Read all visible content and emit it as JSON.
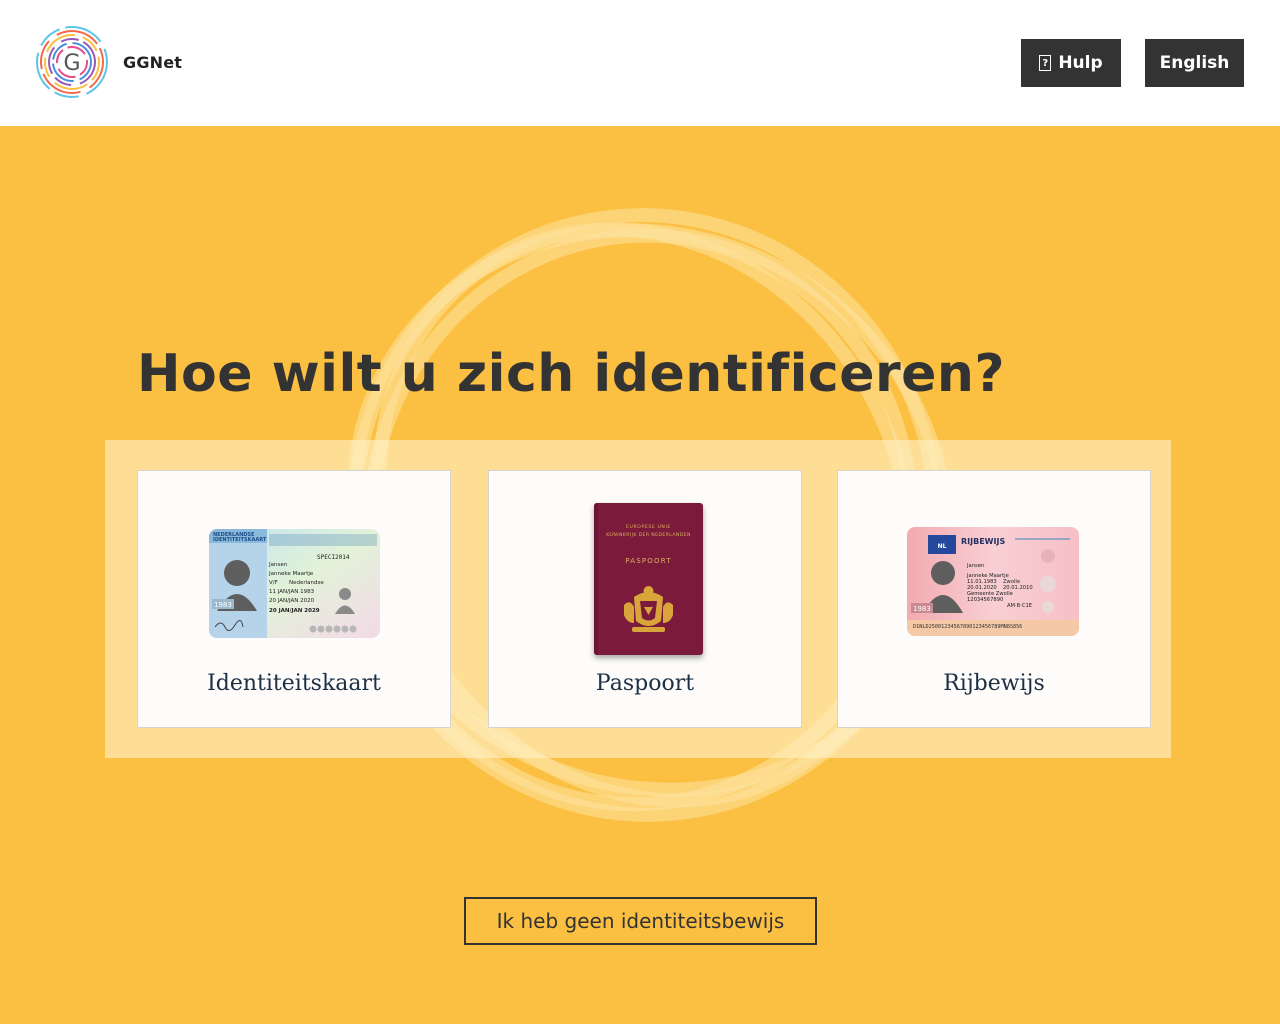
{
  "header": {
    "brand": "GGNet",
    "help_label": "Hulp",
    "language_label": "English"
  },
  "main": {
    "title": "Hoe wilt u zich identificeren?",
    "options": [
      {
        "label": "Identiteitskaart",
        "icon": "id-card-image"
      },
      {
        "label": "Paspoort",
        "icon": "passport-image"
      },
      {
        "label": "Rijbewijs",
        "icon": "drivers-license-image"
      }
    ],
    "no_id_label": "Ik heb geen identiteitsbewijs"
  },
  "id_card": {
    "header_line1": "NEDERLANDSE",
    "header_line2": "IDENTITEITSKAART",
    "doc_number": "SPECI2014",
    "surname": "Jansen",
    "given_names": "Janneke Maartje",
    "sex_nationality": "V/F",
    "nationality": "Nederlandse",
    "birth_date": "11 JAN/JAN 1983",
    "issue_date": "20 JAN/JAN 2020",
    "expiry_date": "20 JAN/JAN 2029",
    "year_badge": "1983"
  },
  "passport": {
    "line1": "EUROPESE UNIE",
    "line2": "KONINKRIJK DER NEDERLANDEN",
    "title": "PASPOORT"
  },
  "license": {
    "country": "NL",
    "title": "RIJBEWIJS",
    "surname": "Jansen",
    "given_names": "Janneke Maartje",
    "birth": "11.01.1983",
    "birth_place": "Zwolle",
    "dates": "20.01.2020",
    "dates_expiry": "20.01.2010",
    "authority": "Gemeente Zwolle",
    "number": "12034567890",
    "categories": "AM·B·C1E",
    "year_badge": "1983",
    "mrz": "D1NLD25001234567890123456789MN8S856"
  },
  "colors": {
    "background": "#fbbf42",
    "header_bg": "#ffffff",
    "button_dark": "#333333",
    "heading_text": "#333333",
    "card_label": "#1b2f45",
    "passport": "#7c1a3c"
  }
}
